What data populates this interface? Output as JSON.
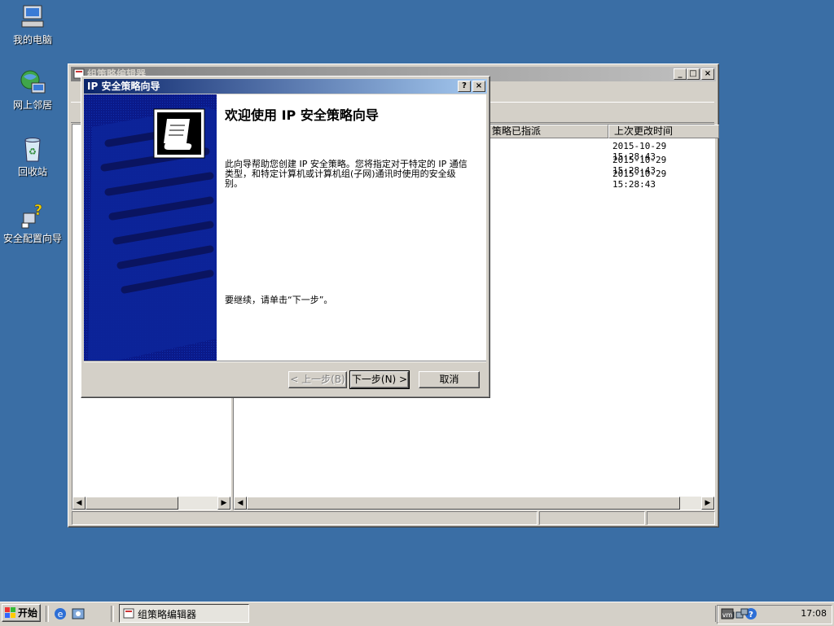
{
  "desktop": {
    "icons": [
      {
        "label": "我的电脑",
        "icon": "my-computer-icon"
      },
      {
        "label": "网上邻居",
        "icon": "network-places-icon"
      },
      {
        "label": "回收站",
        "icon": "recycle-bin-icon"
      },
      {
        "label": "安全配置向导",
        "icon": "security-wizard-icon"
      }
    ]
  },
  "gpo_window": {
    "title": "组策略编辑器",
    "columns": [
      "策略已指派",
      "上次更改时间"
    ],
    "rows": [
      {
        "modified": "2015-10-29 15:28:43"
      },
      {
        "modified": "2015-10-29 15:28:43"
      },
      {
        "modified": "2015-10-29 15:28:43"
      }
    ]
  },
  "wizard": {
    "title": "IP 安全策略向导",
    "heading": "欢迎使用 IP 安全策略向导",
    "body": "此向导帮助您创建 IP 安全策略。您将指定对于特定的 IP 通信类型，和特定计算机或计算机组(子网)通讯时使用的安全级别。",
    "continue_text": "要继续，请单击“下一步”。",
    "buttons": {
      "back": "< 上一步(B)",
      "next": "下一步(N) >",
      "cancel": "取消"
    },
    "help_label": "?",
    "close_label": "×"
  },
  "taskbar": {
    "start_label": "开始",
    "task_label": "组策略编辑器",
    "clock": "17:08"
  },
  "colors": {
    "desktop": "#3a6ea5",
    "titlebar_active": "#0a246a",
    "wizard_panel": "#0a1a8a"
  }
}
